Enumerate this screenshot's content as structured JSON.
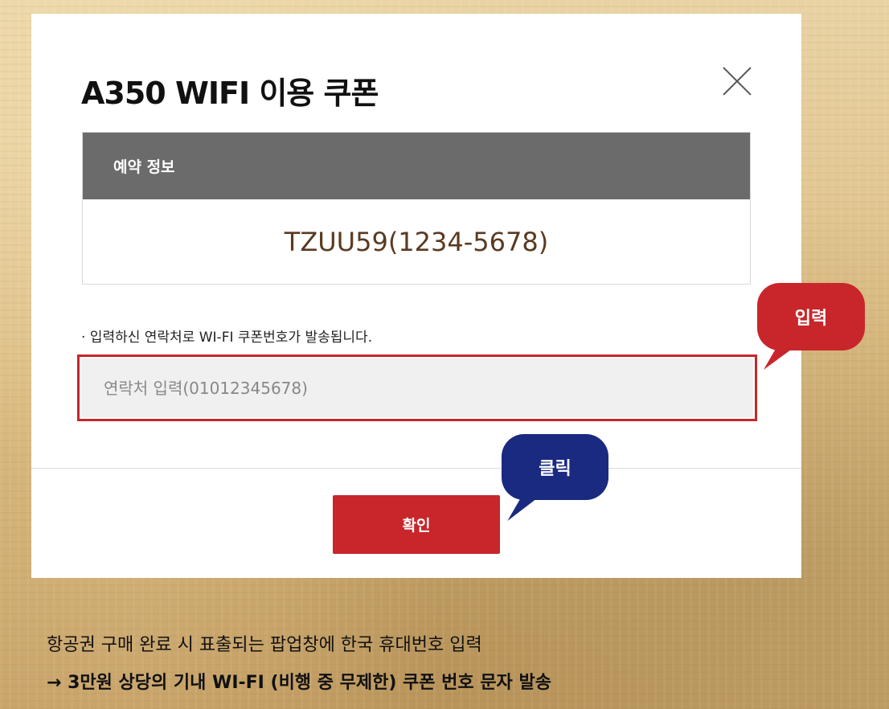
{
  "modal": {
    "title": "A350 WIFI 이용 쿠폰",
    "close_icon": "close-icon"
  },
  "reservation": {
    "header": "예약 정보",
    "value": "TZUU59(1234-5678)"
  },
  "notice": "· 입력하신 연락처로 WI-FI 쿠폰번호가 발송됩니다.",
  "phone_input": {
    "placeholder": "연락처 입력(01012345678)",
    "value": ""
  },
  "confirm_label": "확인",
  "annotations": {
    "input_label": "입력",
    "click_label": "클릭",
    "input_color": "#c8262a",
    "click_color": "#1a2a80"
  },
  "caption": {
    "line1": "항공권 구매 완료 시 표출되는 팝업창에 한국 휴대번호 입력",
    "line2": "→ 3만원 상당의 기내 WI-FI (비행 중 무제한) 쿠폰 번호 문자 발송"
  }
}
